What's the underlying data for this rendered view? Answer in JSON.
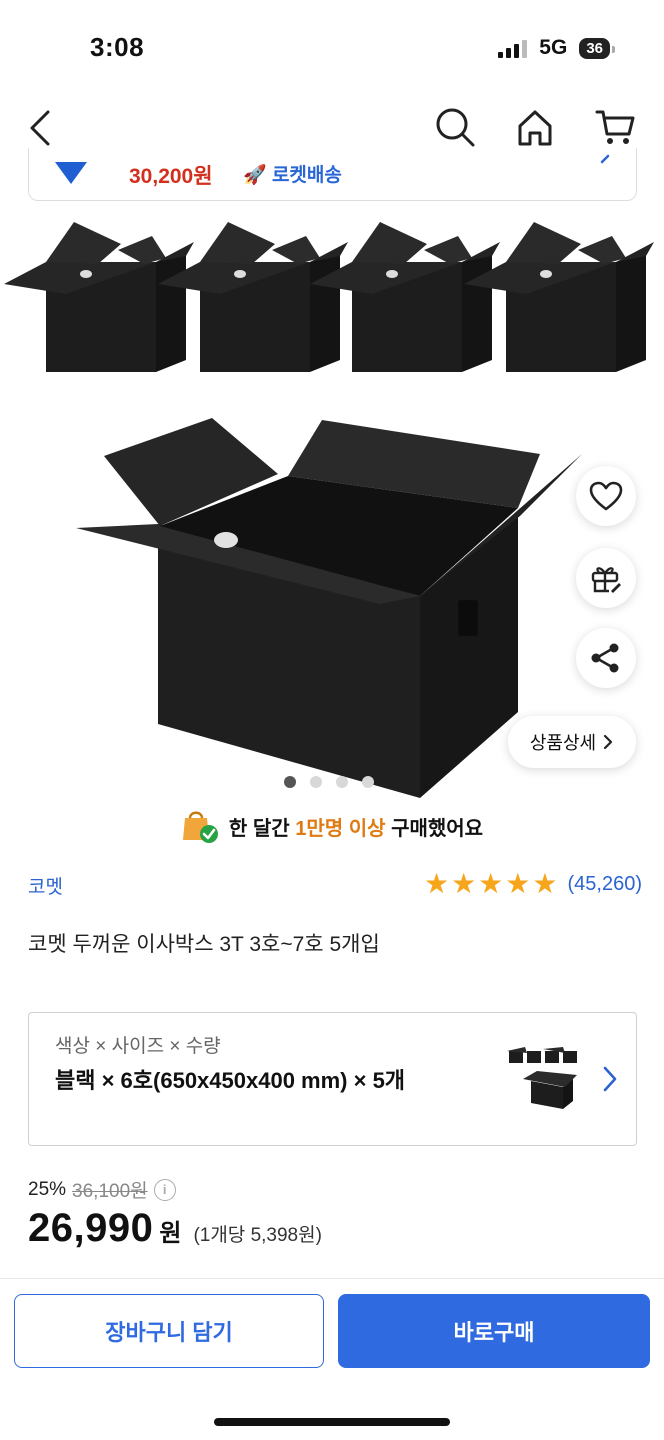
{
  "status_bar": {
    "time": "3:08",
    "network": "5G",
    "battery": "36"
  },
  "nav": {
    "back_icon": "chevron-left-icon",
    "search_icon": "search-icon",
    "home_icon": "home-icon",
    "cart_icon": "cart-icon"
  },
  "pinned_strip": {
    "price": "30,200원",
    "rocket_label": "로켓배송"
  },
  "gallery": {
    "detail_button": "상품상세",
    "page_count": 4,
    "active_page": 1
  },
  "social_proof": {
    "prefix": "한 달간 ",
    "highlight": "1만명 이상",
    "suffix": " 구매했어요"
  },
  "product": {
    "brand": "코멧",
    "rating": 5,
    "review_count": "(45,260)",
    "title": "코멧 두꺼운 이사박스 3T 3호~7호 5개입"
  },
  "option": {
    "label": "색상 × 사이즈 × 수량",
    "value": "블랙 × 6호(650x450x400 mm) × 5개"
  },
  "price": {
    "discount": "25%",
    "original": "36,100원",
    "sale": "26,990",
    "currency": "원",
    "unit_price": "(1개당 5,398원)"
  },
  "actions": {
    "cart": "장바구니 담기",
    "buy": "바로구매"
  },
  "colors": {
    "accent": "#2f6ae0",
    "price_red": "#d2301e",
    "star": "#f7a51b",
    "highlight_orange": "#e07a12"
  }
}
